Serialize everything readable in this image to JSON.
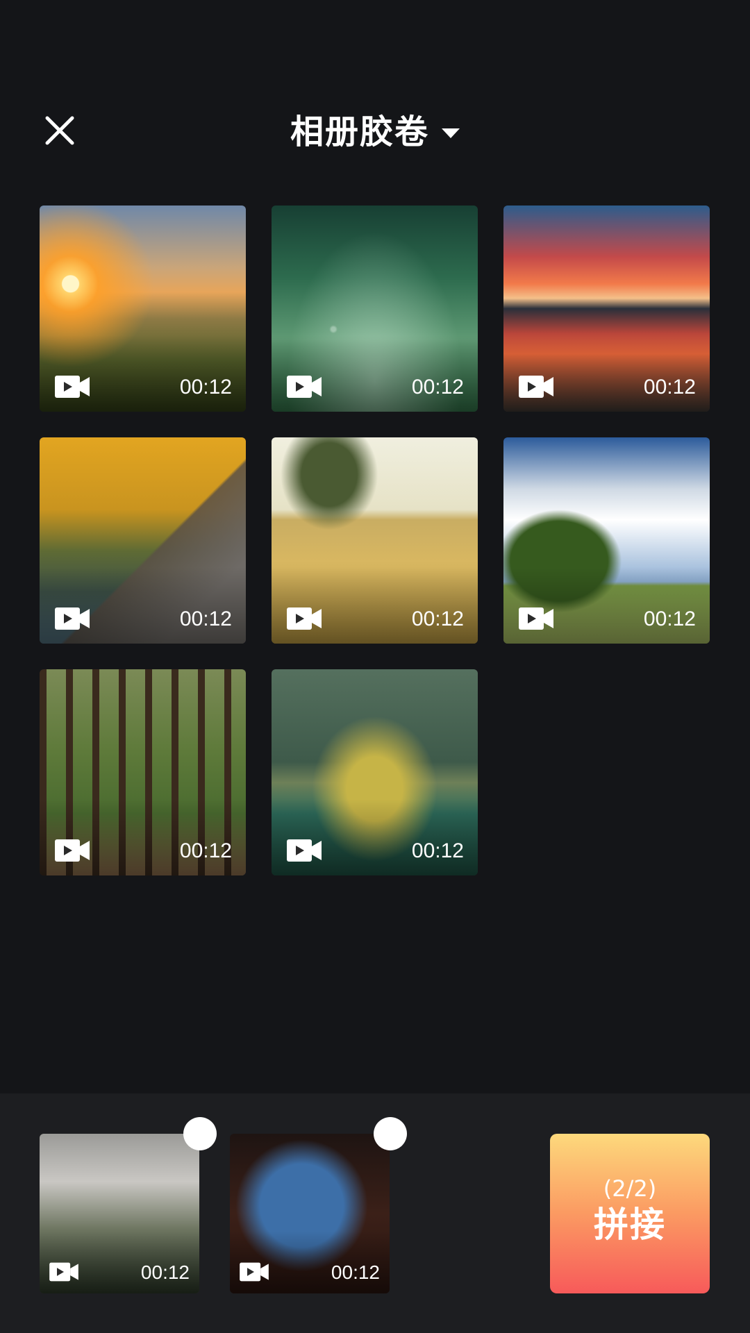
{
  "header": {
    "title": "相册胶卷",
    "close_icon": "close-icon",
    "dropdown_icon": "chevron-down-icon"
  },
  "gallery": {
    "items": [
      {
        "name": "video-thumbnail-sunset",
        "duration": "00:12",
        "icon": "video-camera-icon"
      },
      {
        "name": "video-thumbnail-flowers",
        "duration": "00:12",
        "icon": "video-camera-icon"
      },
      {
        "name": "video-thumbnail-reflection",
        "duration": "00:12",
        "icon": "video-camera-icon"
      },
      {
        "name": "video-thumbnail-autumn-forest",
        "duration": "00:12",
        "icon": "video-camera-icon"
      },
      {
        "name": "video-thumbnail-field",
        "duration": "00:12",
        "icon": "video-camera-icon"
      },
      {
        "name": "video-thumbnail-tree",
        "duration": "00:12",
        "icon": "video-camera-icon"
      },
      {
        "name": "video-thumbnail-woods",
        "duration": "00:12",
        "icon": "video-camera-icon"
      },
      {
        "name": "video-thumbnail-lake",
        "duration": "00:12",
        "icon": "video-camera-icon"
      }
    ]
  },
  "selected": {
    "items": [
      {
        "name": "selected-thumbnail-fog",
        "duration": "00:12",
        "icon": "video-camera-icon"
      },
      {
        "name": "selected-thumbnail-cave",
        "duration": "00:12",
        "icon": "video-camera-icon"
      }
    ]
  },
  "merge_button": {
    "count": "(2/2)",
    "label": "拼接",
    "gradient_top": "#fdd97c",
    "gradient_bottom": "#f75a5a"
  },
  "colors": {
    "background": "#141518",
    "tray": "#1d1e21",
    "text": "#ffffff"
  }
}
